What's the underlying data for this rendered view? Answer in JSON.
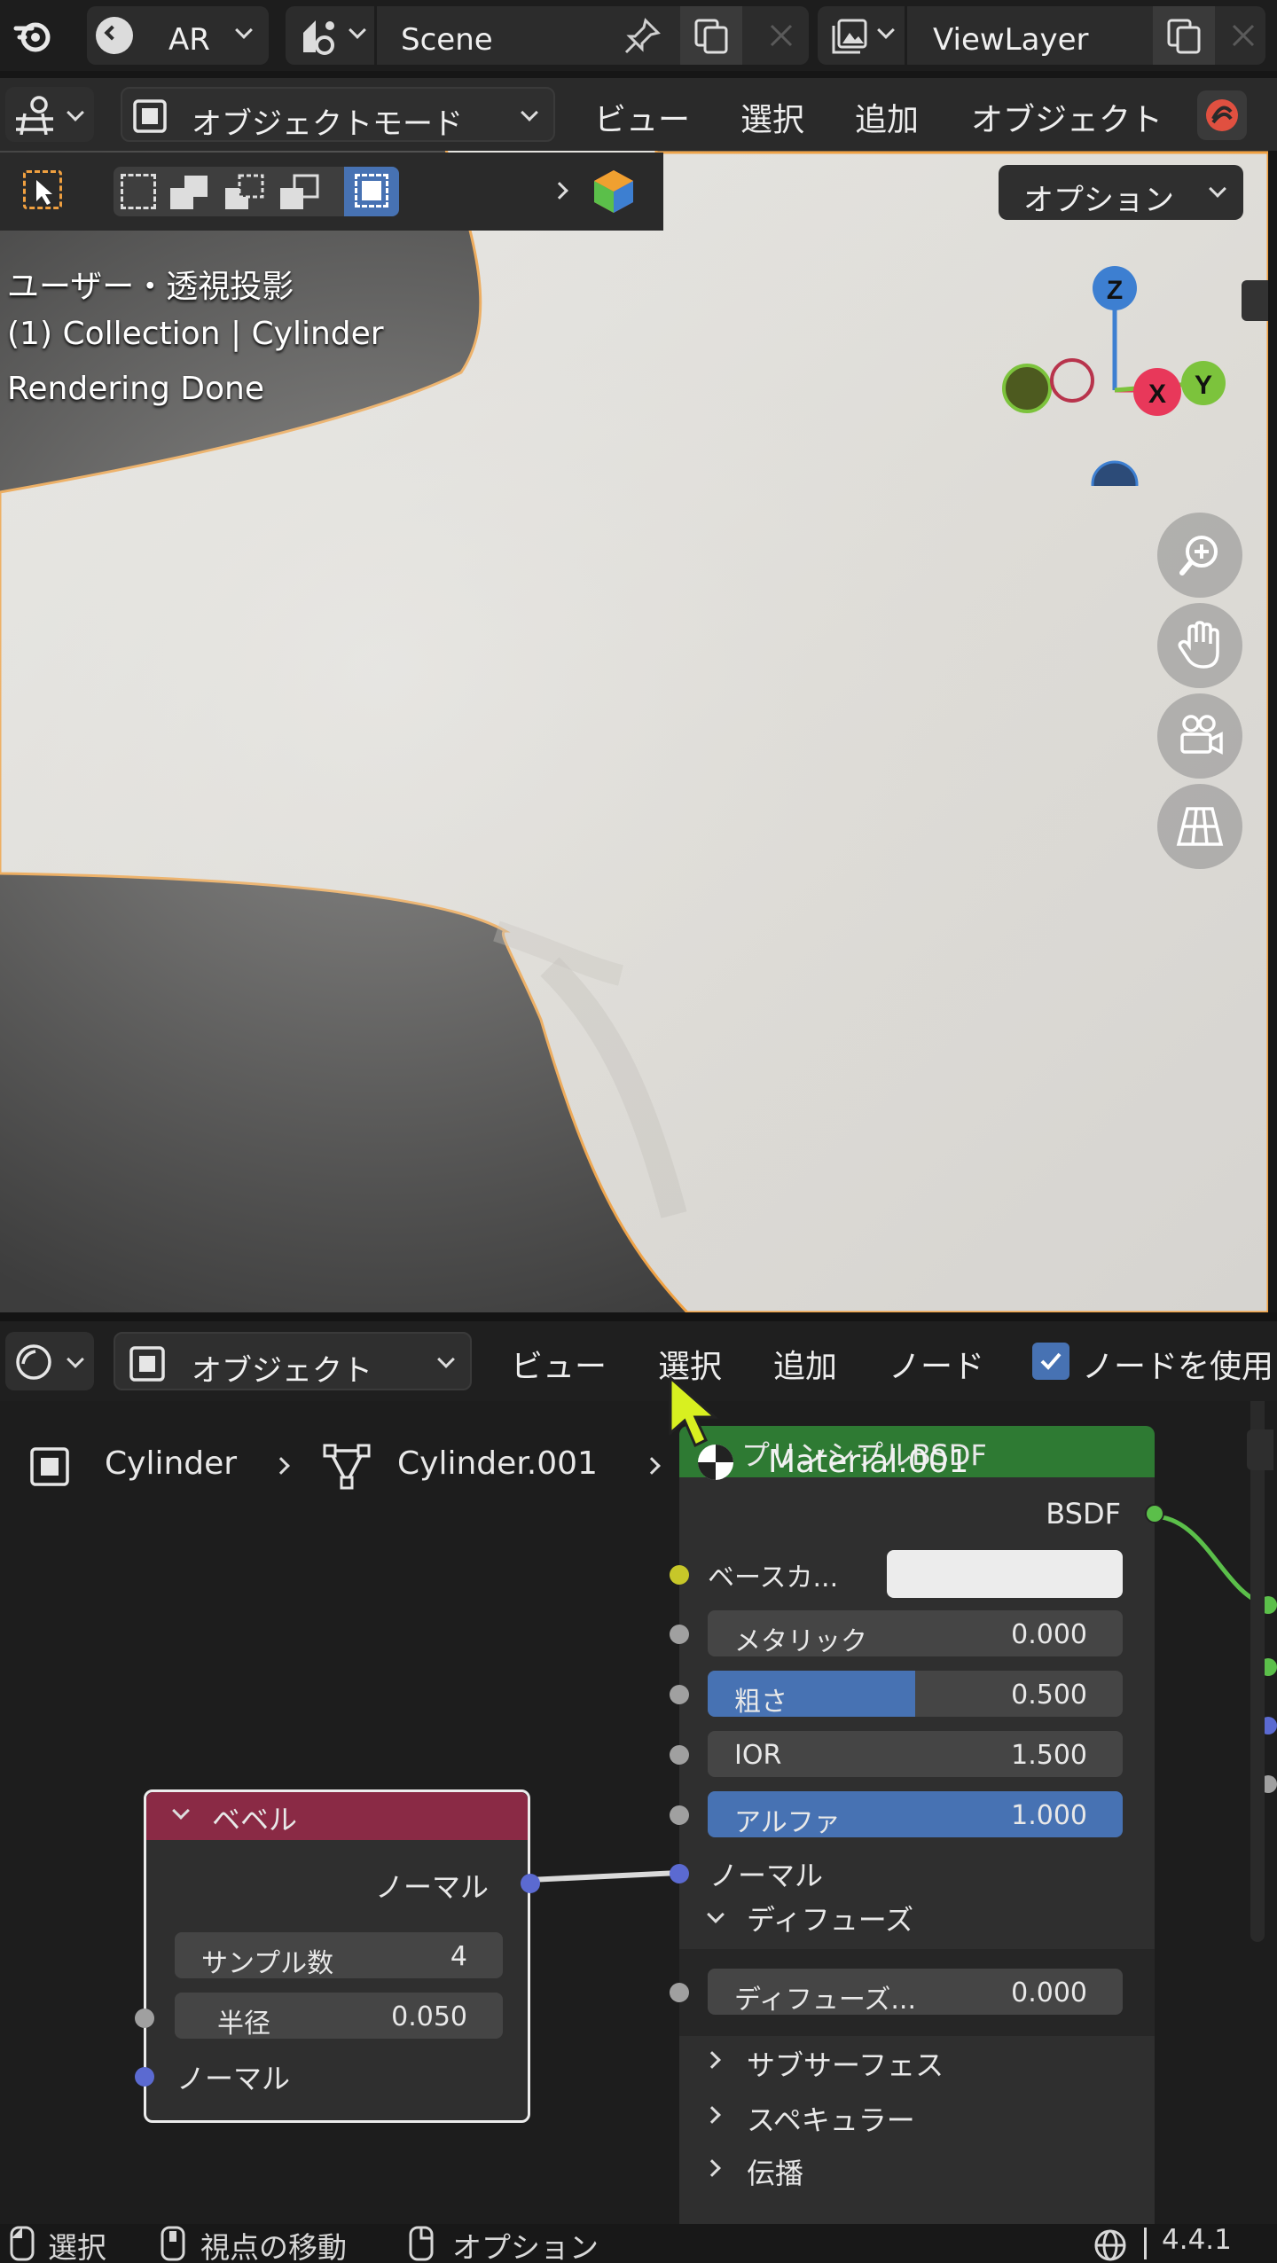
{
  "topbar": {
    "workspace": "AR",
    "scene": "Scene",
    "view_layer": "ViewLayer"
  },
  "viewport": {
    "mode": "オブジェクトモード",
    "menu": [
      "ビュー",
      "選択",
      "追加",
      "オブジェクト"
    ],
    "options": "オプション",
    "overlay": {
      "view_name": "ユーザー・透視投影",
      "collection": "(1) Collection | Cylinder",
      "status": "Rendering Done"
    },
    "gizmo": {
      "z": "Z",
      "x": "X",
      "y": "Y"
    },
    "colors": {
      "x": "#e8385a",
      "y": "#7cc33c",
      "z": "#3d7fd1"
    }
  },
  "node_editor": {
    "editor_mode": "オブジェクト",
    "menu": [
      "ビュー",
      "選択",
      "追加",
      "ノード"
    ],
    "use_nodes": "ノードを使用",
    "breadcrumb": [
      "Cylinder",
      "Cylinder.001",
      "Material.001"
    ],
    "principled": {
      "title": "プリンシプルBSDF",
      "output": "BSDF",
      "base_color_label": "ベースカ...",
      "fields": [
        {
          "label": "メタリック",
          "value": "0.000",
          "fill": 0
        },
        {
          "label": "粗さ",
          "value": "0.500",
          "fill": 0.5
        },
        {
          "label": "IOR",
          "value": "1.500",
          "fill": 0
        },
        {
          "label": "アルファ",
          "value": "1.000",
          "fill": 1
        }
      ],
      "normal": "ノーマル",
      "diffuse_section": "ディフューズ",
      "diffuse_field": {
        "label": "ディフューズ...",
        "value": "0.000"
      },
      "subsections": [
        "サブサーフェス",
        "スペキュラー",
        "伝播"
      ]
    },
    "bevel": {
      "title": "ベベル",
      "output": "ノーマル",
      "samples": {
        "label": "サンプル数",
        "value": "4"
      },
      "radius": {
        "label": "半径",
        "value": "0.050"
      },
      "input": "ノーマル"
    }
  },
  "statusbar": {
    "select": "選択",
    "move_view": "視点の移動",
    "options": "オプション",
    "version": "4.4.1"
  }
}
